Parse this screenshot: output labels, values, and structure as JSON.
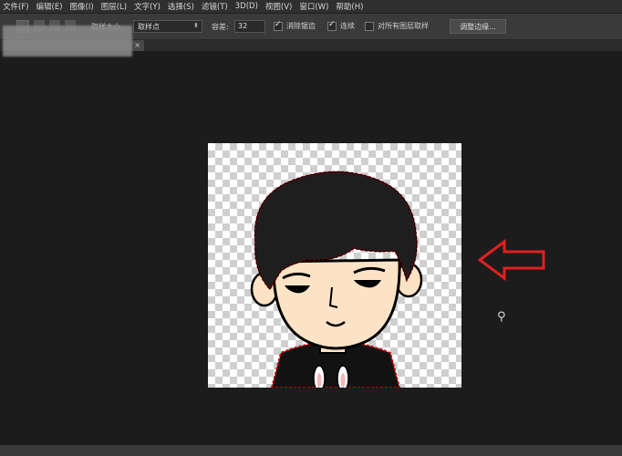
{
  "menu": [
    "文件(F)",
    "编辑(E)",
    "图像(I)",
    "图层(L)",
    "文字(Y)",
    "选择(S)",
    "滤镜(T)",
    "3D(D)",
    "视图(V)",
    "窗口(W)",
    "帮助(H)"
  ],
  "options": {
    "sample_label": "取样大小:",
    "sample_value": "取样点",
    "tolerance_label": "容差:",
    "tolerance_value": "32",
    "antialias_label": "消除锯齿",
    "contiguous_label": "连续",
    "all_layers_label": "对所有图层取样",
    "refine_button": "调整边缘..."
  },
  "doc_tab": {
    "close": "×"
  },
  "icons": {
    "wand": "magic-wand-cursor-icon",
    "arrow": "red-outline-arrow-icon"
  },
  "colors": {
    "accent_arrow": "#e02020",
    "selection": "#c00000"
  }
}
